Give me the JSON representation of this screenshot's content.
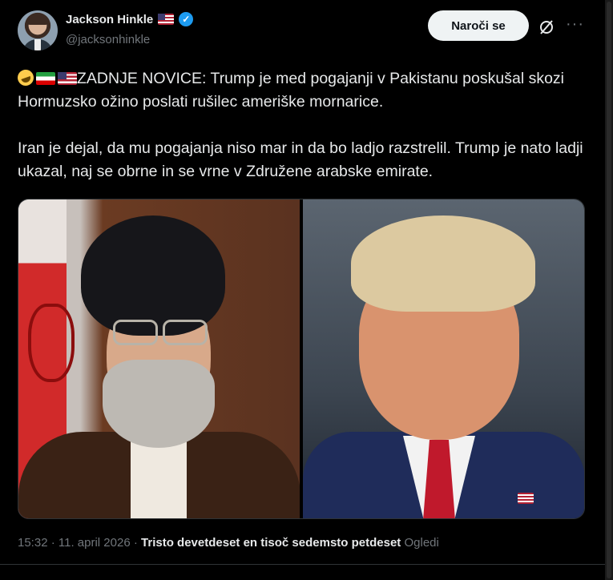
{
  "author": {
    "display_name": "Jackson Hinkle",
    "handle": "@jacksonhinkle",
    "verified": true,
    "flag": "us-flag"
  },
  "actions": {
    "follow_label": "Naroči se",
    "grok_icon": "grok-icon",
    "more_icon": "more-icon"
  },
  "tweet": {
    "paragraph1_text": "ZADNJE NOVICE: Trump je med pogajanji v Pakistanu poskušal skozi Hormuzsko ožino poslati rušilec ameriške mornarice.",
    "paragraph2": "Iran je dejal, da mu pogajanja niso mar in da bo ladjo razstrelil. Trump je nato ladji ukazal, naj se obrne in se vrne v Združene arabske emirate.",
    "emojis": [
      "rolling-on-floor-laughing",
      "iran-flag",
      "us-flag"
    ]
  },
  "meta": {
    "time": "15:32",
    "separator": " · ",
    "date": "11. april 2026",
    "views_count": "Tristo devetdeset en tisoč sedemsto petdeset",
    "views_label": "Ogledi"
  },
  "colors": {
    "background": "#000000",
    "text": "#e7e9ea",
    "muted": "#71767b",
    "verified": "#1d9bf0",
    "follow_bg": "#eff3f4"
  }
}
